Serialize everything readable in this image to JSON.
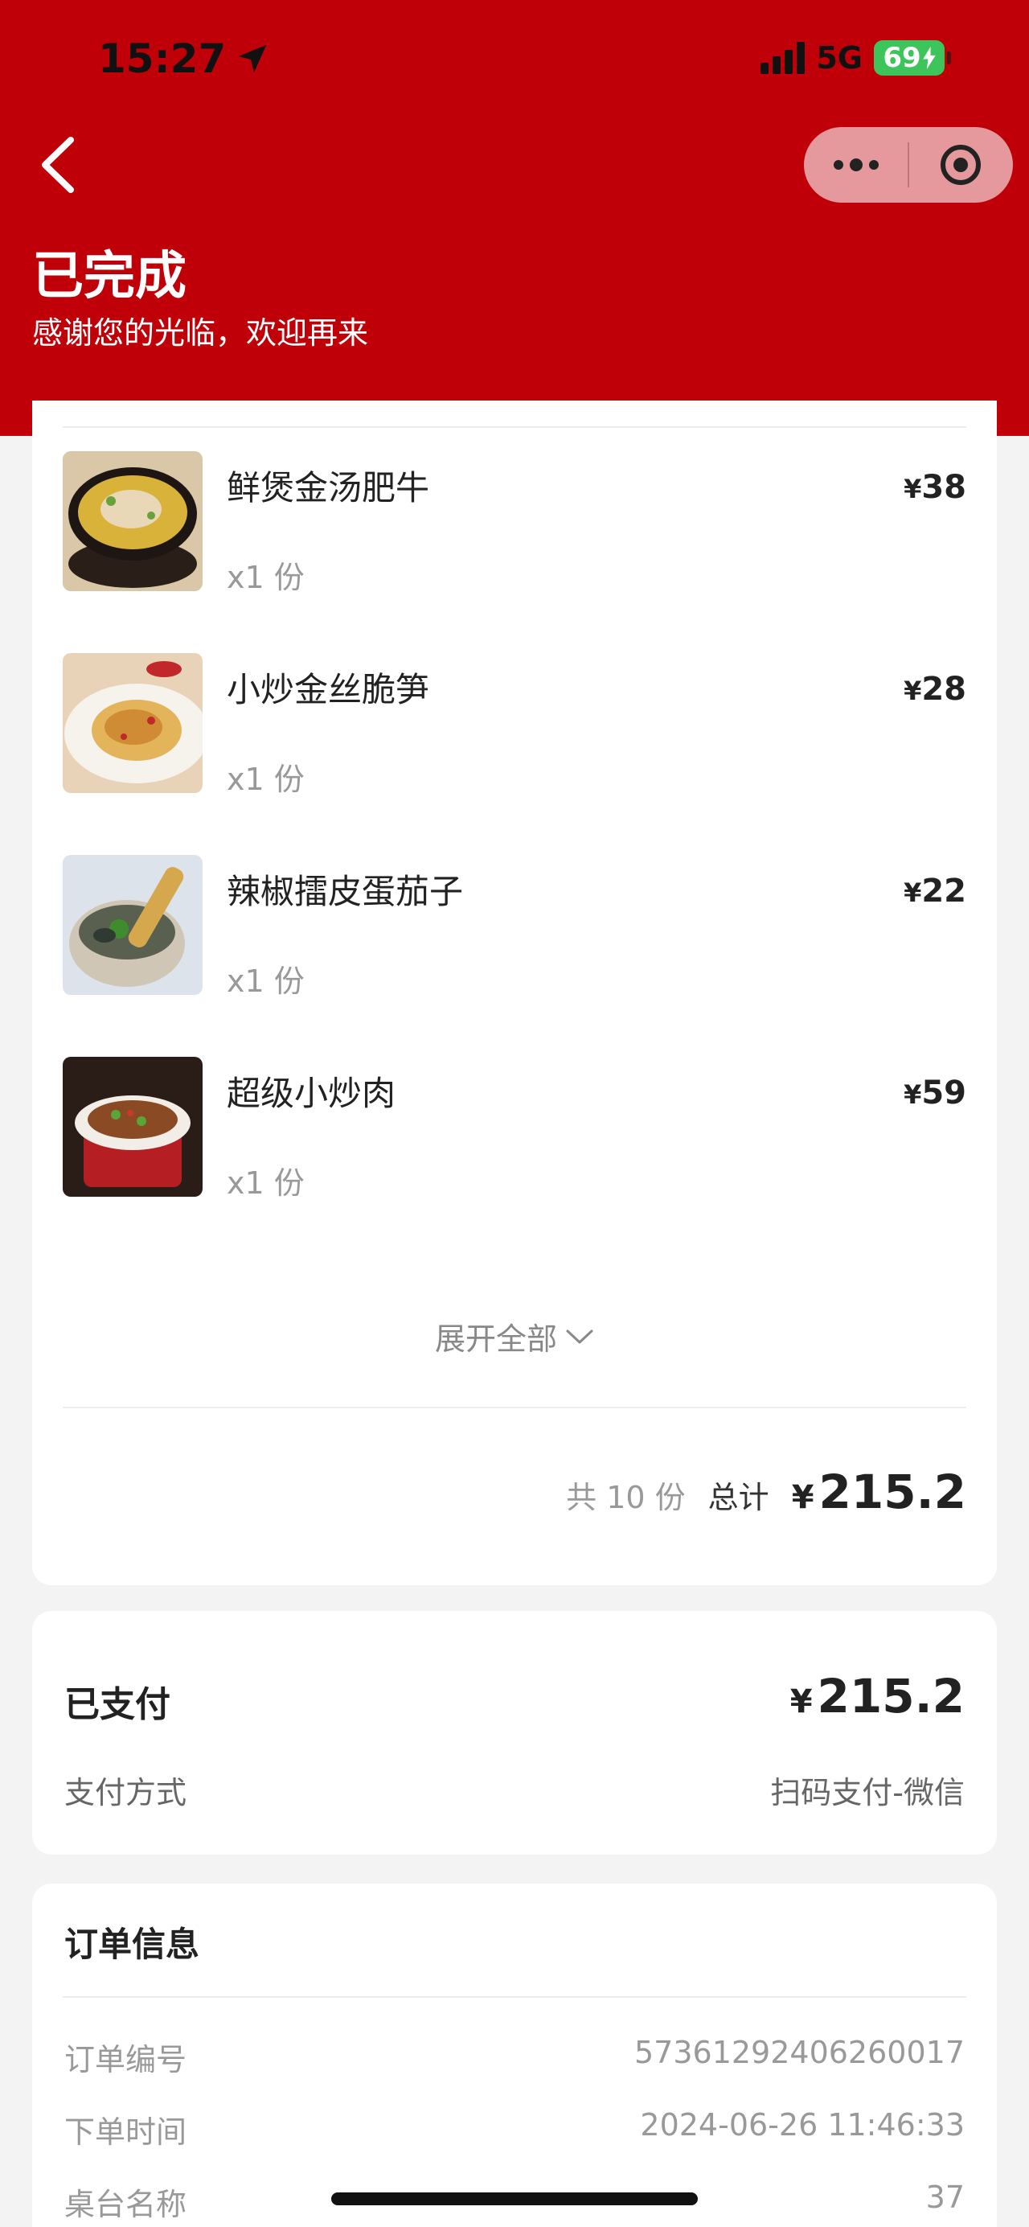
{
  "status_bar": {
    "time": "15:27",
    "network": "5G",
    "battery": "69"
  },
  "header": {
    "title": "已完成",
    "subtitle": "感谢您的光临，欢迎再来",
    "back_icon": "chevron-left-icon",
    "more_icon": "more-dots-icon",
    "close_icon": "target-circle-icon"
  },
  "colors": {
    "brand_red": "#bf0008",
    "text": "#222222",
    "muted": "#999999",
    "battery_green": "#3dc45a"
  },
  "items": [
    {
      "name": "鲜煲金汤肥牛",
      "qty": "x1 份",
      "currency": "¥",
      "price": "38"
    },
    {
      "name": "小炒金丝脆笋",
      "qty": "x1 份",
      "currency": "¥",
      "price": "28"
    },
    {
      "name": "辣椒擂皮蛋茄子",
      "qty": "x1 份",
      "currency": "¥",
      "price": "22"
    },
    {
      "name": "超级小炒肉",
      "qty": "x1 份",
      "currency": "¥",
      "price": "59"
    }
  ],
  "expand_label": "展开全部",
  "summary": {
    "count_text": "共 10 份",
    "total_label": "总计",
    "currency": "¥",
    "total": "215.2"
  },
  "payment": {
    "paid_label": "已支付",
    "currency": "¥",
    "paid_amount": "215.2",
    "method_label": "支付方式",
    "method_value": "扫码支付-微信"
  },
  "order_info": {
    "title": "订单信息",
    "rows": [
      {
        "label": "订单编号",
        "value": "57361292406260017"
      },
      {
        "label": "下单时间",
        "value": "2024-06-26 11:46:33"
      },
      {
        "label": "桌台名称",
        "value": "37"
      }
    ]
  }
}
